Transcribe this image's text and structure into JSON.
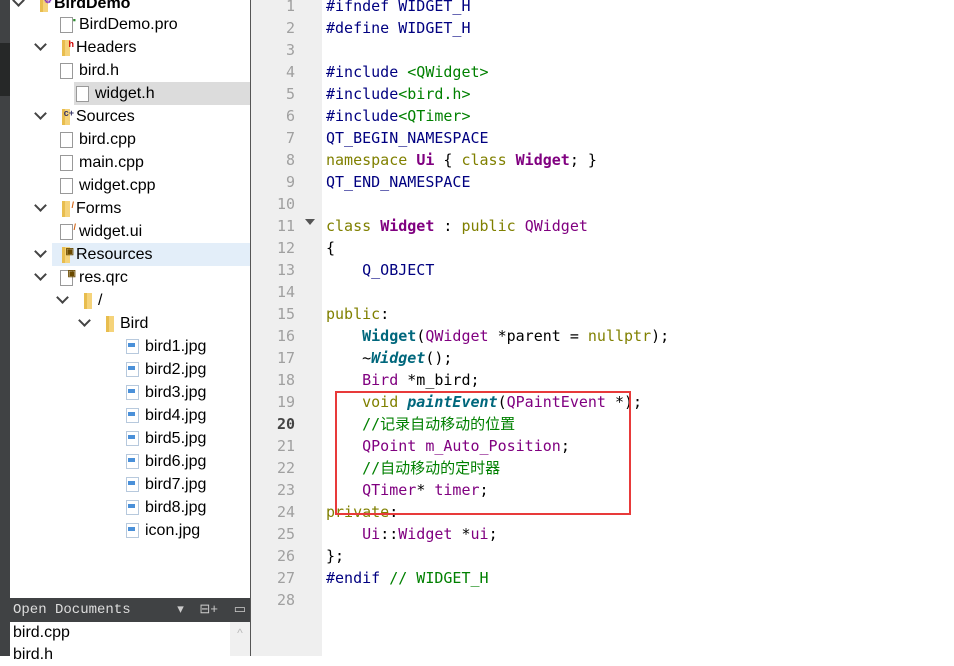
{
  "project_tree": {
    "items": [
      {
        "label": "BirdDemo",
        "type": "project",
        "level": 0,
        "expanded": true
      },
      {
        "label": "BirdDemo.pro",
        "type": "pro-file",
        "level": 1
      },
      {
        "label": "Headers",
        "type": "folder-headers",
        "level": 1,
        "expanded": true
      },
      {
        "label": "bird.h",
        "type": "file",
        "level": 2
      },
      {
        "label": "widget.h",
        "type": "file",
        "level": 2,
        "selected": true
      },
      {
        "label": "Sources",
        "type": "folder-sources",
        "level": 1,
        "expanded": true
      },
      {
        "label": "bird.cpp",
        "type": "file",
        "level": 2
      },
      {
        "label": "main.cpp",
        "type": "file",
        "level": 2
      },
      {
        "label": "widget.cpp",
        "type": "file",
        "level": 2
      },
      {
        "label": "Forms",
        "type": "folder-forms",
        "level": 1,
        "expanded": true
      },
      {
        "label": "widget.ui",
        "type": "ui-file",
        "level": 2
      },
      {
        "label": "Resources",
        "type": "folder-resources",
        "level": 1,
        "expanded": true,
        "hovered": true
      },
      {
        "label": "res.qrc",
        "type": "qrc-file",
        "level": 2,
        "expanded": true
      },
      {
        "label": "/",
        "type": "folder",
        "level": 3,
        "expanded": true
      },
      {
        "label": "Bird",
        "type": "folder",
        "level": 4,
        "expanded": true
      },
      {
        "label": "bird1.jpg",
        "type": "image",
        "level": 5
      },
      {
        "label": "bird2.jpg",
        "type": "image",
        "level": 5
      },
      {
        "label": "bird3.jpg",
        "type": "image",
        "level": 5
      },
      {
        "label": "bird4.jpg",
        "type": "image",
        "level": 5
      },
      {
        "label": "bird5.jpg",
        "type": "image",
        "level": 5
      },
      {
        "label": "bird6.jpg",
        "type": "image",
        "level": 5
      },
      {
        "label": "bird7.jpg",
        "type": "image",
        "level": 5
      },
      {
        "label": "bird8.jpg",
        "type": "image",
        "level": 5
      },
      {
        "label": "icon.jpg",
        "type": "image",
        "level": 5
      }
    ]
  },
  "open_documents": {
    "title": "Open Documents",
    "dropdown_icon": "▾",
    "split_icon": "⊟+",
    "close_icon": "▭",
    "items": [
      "bird.cpp",
      "bird.h"
    ]
  },
  "editor": {
    "current_line": 20,
    "line_numbers": [
      "1",
      "2",
      "3",
      "4",
      "5",
      "6",
      "7",
      "8",
      "9",
      "10",
      "11",
      "12",
      "13",
      "14",
      "15",
      "16",
      "17",
      "18",
      "19",
      "20",
      "21",
      "22",
      "23",
      "24",
      "25",
      "26",
      "27",
      "28"
    ],
    "lines": [
      [
        [
          "pp",
          "#ifndef WIDGET_H"
        ]
      ],
      [
        [
          "pp",
          "#define WIDGET_H"
        ]
      ],
      [],
      [
        [
          "pp",
          "#include "
        ],
        [
          "inc",
          "<QWidget>"
        ]
      ],
      [
        [
          "pp",
          "#include"
        ],
        [
          "inc",
          "<bird.h>"
        ]
      ],
      [
        [
          "pp",
          "#include"
        ],
        [
          "inc",
          "<QTimer>"
        ]
      ],
      [
        [
          "mac",
          "QT_BEGIN_NAMESPACE"
        ]
      ],
      [
        [
          "kw",
          "namespace "
        ],
        [
          "cls",
          "Ui"
        ],
        [
          "pl",
          " { "
        ],
        [
          "kw",
          "class "
        ],
        [
          "cls",
          "Widget"
        ],
        [
          "pl",
          "; }"
        ]
      ],
      [
        [
          "mac",
          "QT_END_NAMESPACE"
        ]
      ],
      [],
      [
        [
          "kw",
          "class "
        ],
        [
          "cls",
          "Widget"
        ],
        [
          "pl",
          " : "
        ],
        [
          "kw",
          "public "
        ],
        [
          "ty",
          "QWidget"
        ]
      ],
      [
        [
          "pl",
          "{"
        ]
      ],
      [
        [
          "mac",
          "    Q_OBJECT"
        ]
      ],
      [],
      [
        [
          "kw",
          "public"
        ],
        [
          "pl",
          ":"
        ]
      ],
      [
        [
          "pl",
          "    "
        ],
        [
          "fnb",
          "Widget"
        ],
        [
          "pl",
          "("
        ],
        [
          "ty",
          "QWidget"
        ],
        [
          "pl",
          " *parent = "
        ],
        [
          "kw",
          "nullptr"
        ],
        [
          "pl",
          ");"
        ]
      ],
      [
        [
          "pl",
          "    ~"
        ],
        [
          "fn",
          "Widget"
        ],
        [
          "pl",
          "();"
        ]
      ],
      [
        [
          "pl",
          "    "
        ],
        [
          "ty",
          "Bird"
        ],
        [
          "pl",
          " *m_bird;"
        ]
      ],
      [
        [
          "pl",
          "    "
        ],
        [
          "kw",
          "void "
        ],
        [
          "fn",
          "paintEvent"
        ],
        [
          "pl",
          "("
        ],
        [
          "ty",
          "QPaintEvent"
        ],
        [
          "pl",
          " *);"
        ]
      ],
      [
        [
          "pl",
          "    "
        ],
        [
          "cm",
          "//记录自动移动的位置"
        ]
      ],
      [
        [
          "pl",
          "    "
        ],
        [
          "ty",
          "QPoint"
        ],
        [
          "pl",
          " "
        ],
        [
          "ty",
          "m_Auto_Position"
        ],
        [
          "pl",
          ";"
        ]
      ],
      [
        [
          "pl",
          "    "
        ],
        [
          "cm",
          "//自动移动的定时器"
        ]
      ],
      [
        [
          "pl",
          "    "
        ],
        [
          "ty",
          "QTimer"
        ],
        [
          "pl",
          "* "
        ],
        [
          "ty",
          "timer"
        ],
        [
          "pl",
          ";"
        ]
      ],
      [
        [
          "kw",
          "private"
        ],
        [
          "pl",
          ":"
        ]
      ],
      [
        [
          "pl",
          "    "
        ],
        [
          "ty",
          "Ui"
        ],
        [
          "pl",
          "::"
        ],
        [
          "ty",
          "Widget"
        ],
        [
          "pl",
          " *"
        ],
        [
          "ty",
          "ui"
        ],
        [
          "pl",
          ";"
        ]
      ],
      [
        [
          "pl",
          "};"
        ]
      ],
      [
        [
          "pp",
          "#endif "
        ],
        [
          "cm",
          "// WIDGET_H"
        ]
      ],
      []
    ]
  },
  "annotation": {
    "color": "#e83a3a",
    "highlighted_lines": "19-23"
  }
}
